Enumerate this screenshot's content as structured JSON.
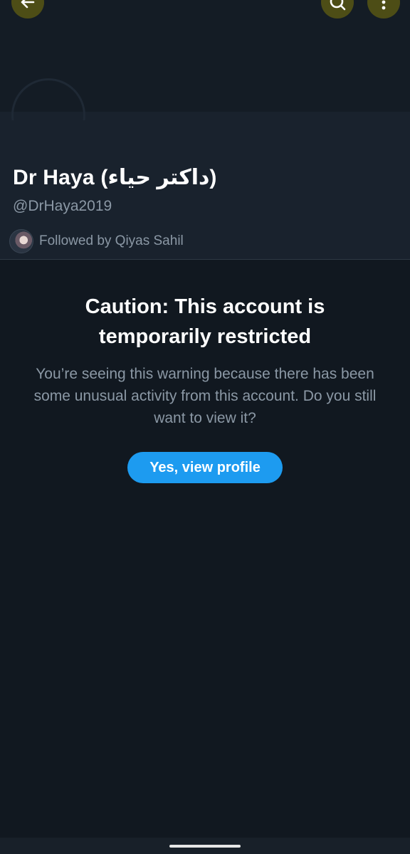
{
  "profile": {
    "display_name": "Dr Haya (داكتر حياء)",
    "handle": "@DrHaya2019",
    "followed_by": "Followed by Qiyas Sahil"
  },
  "header": {
    "back_icon": "arrow-left-icon",
    "search_icon": "search-icon",
    "more_icon": "more-vertical-icon"
  },
  "warning": {
    "title": "Caution: This account is temporarily restricted",
    "body": "You’re seeing this warning because there has been some unusual activity from this account. Do you still want to view it?",
    "button_label": "Yes, view profile"
  },
  "colors": {
    "background": "#111820",
    "accent": "#1d9bf0",
    "header_buttons": "#4d4d16"
  }
}
